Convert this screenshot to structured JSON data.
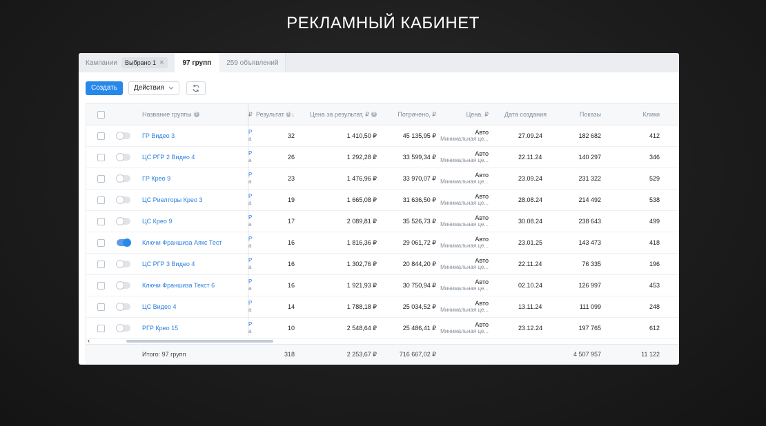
{
  "page_title": "РЕКЛАМНЫЙ КАБИНЕТ",
  "tabs": {
    "campaigns": "Кампании",
    "selected_chip": "Выбрано 1",
    "groups": "97 групп",
    "ads": "259 объявлений"
  },
  "toolbar": {
    "create": "Создать",
    "actions": "Действия"
  },
  "columns": {
    "name": "Название группы",
    "cut_col": "₽",
    "result": "Результат",
    "price_per_result": "Цена за результат, ₽",
    "spent": "Потрачено, ₽",
    "price": "Цена, ₽",
    "created": "Дата создания",
    "impressions": "Показы",
    "clicks": "Клики"
  },
  "rows": [
    {
      "name": "ГР Видео 3",
      "enabled": false,
      "sliver_a": "Р",
      "sliver_b": "а",
      "result": "32",
      "ppr": "1 410,50 ₽",
      "spent": "45 135,95 ₽",
      "price": "Авто",
      "price_sub": "Минимальная це...",
      "created": "27.09.24",
      "impressions": "182 682",
      "clicks": "412"
    },
    {
      "name": "ЦС РГР 2 Видео 4",
      "enabled": false,
      "sliver_a": "Р",
      "sliver_b": "а",
      "result": "26",
      "ppr": "1 292,28 ₽",
      "spent": "33 599,34 ₽",
      "price": "Авто",
      "price_sub": "Минимальная це...",
      "created": "22.11.24",
      "impressions": "140 297",
      "clicks": "346"
    },
    {
      "name": "ГР Крео 9",
      "enabled": false,
      "sliver_a": "Р",
      "sliver_b": "а",
      "result": "23",
      "ppr": "1 476,96 ₽",
      "spent": "33 970,07 ₽",
      "price": "Авто",
      "price_sub": "Минимальная це...",
      "created": "23.09.24",
      "impressions": "231 322",
      "clicks": "529"
    },
    {
      "name": "ЦС Риелторы Крео 3",
      "enabled": false,
      "sliver_a": "Р",
      "sliver_b": "а",
      "result": "19",
      "ppr": "1 665,08 ₽",
      "spent": "31 636,50 ₽",
      "price": "Авто",
      "price_sub": "Минимальная це...",
      "created": "28.08.24",
      "impressions": "214 492",
      "clicks": "538"
    },
    {
      "name": "ЦС Крео 9",
      "enabled": false,
      "sliver_a": "Р",
      "sliver_b": "а",
      "result": "17",
      "ppr": "2 089,81 ₽",
      "spent": "35 526,73 ₽",
      "price": "Авто",
      "price_sub": "Минимальная це...",
      "created": "30.08.24",
      "impressions": "238 643",
      "clicks": "499"
    },
    {
      "name": "Ключи Франшиза Аякс Тест",
      "enabled": true,
      "sliver_a": "Р",
      "sliver_b": "а",
      "result": "16",
      "ppr": "1 816,36 ₽",
      "spent": "29 061,72 ₽",
      "price": "Авто",
      "price_sub": "Минимальная це...",
      "created": "23.01.25",
      "impressions": "143 473",
      "clicks": "418"
    },
    {
      "name": "ЦС РГР 3 Видео 4",
      "enabled": false,
      "sliver_a": "Р",
      "sliver_b": "а",
      "result": "16",
      "ppr": "1 302,76 ₽",
      "spent": "20 844,20 ₽",
      "price": "Авто",
      "price_sub": "Минимальная це...",
      "created": "22.11.24",
      "impressions": "76 335",
      "clicks": "196"
    },
    {
      "name": "Ключи Франшиза Текст 6",
      "enabled": false,
      "sliver_a": "Р",
      "sliver_b": "а",
      "result": "16",
      "ppr": "1 921,93 ₽",
      "spent": "30 750,94 ₽",
      "price": "Авто",
      "price_sub": "Минимальная це...",
      "created": "02.10.24",
      "impressions": "126 997",
      "clicks": "453"
    },
    {
      "name": "ЦС Видео 4",
      "enabled": false,
      "sliver_a": "Р",
      "sliver_b": "а",
      "result": "14",
      "ppr": "1 788,18 ₽",
      "spent": "25 034,52 ₽",
      "price": "Авто",
      "price_sub": "Минимальная це...",
      "created": "13.11.24",
      "impressions": "111 099",
      "clicks": "248"
    },
    {
      "name": "РГР Крео 15",
      "enabled": false,
      "sliver_a": "Р",
      "sliver_b": "а",
      "result": "10",
      "ppr": "2 548,64 ₽",
      "spent": "25 486,41 ₽",
      "price": "Авто",
      "price_sub": "Минимальная це...",
      "created": "23.12.24",
      "impressions": "197 765",
      "clicks": "612"
    }
  ],
  "scroll_left_glyph": "‹",
  "totals": {
    "label": "Итого: 97 групп",
    "result": "318",
    "ppr": "2 253,67 ₽",
    "spent": "716 667,02 ₽",
    "impressions": "4 507 957",
    "clicks": "11 122"
  },
  "icons": {
    "help": "?",
    "sort": "↓",
    "close": "×"
  }
}
